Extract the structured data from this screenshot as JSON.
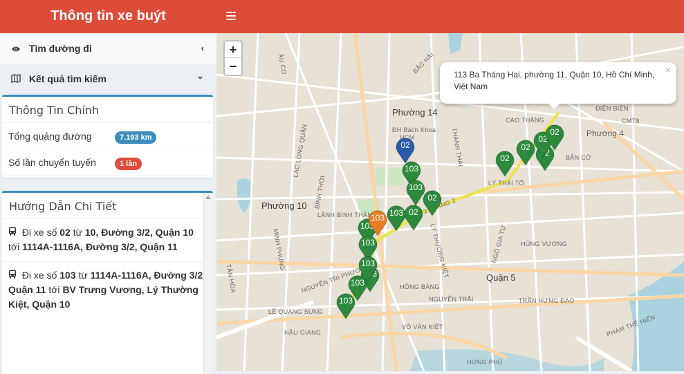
{
  "app": {
    "title": "Thông tin xe buýt"
  },
  "sidebar": {
    "nav": [
      {
        "label": "Tìm đường đi",
        "icon": "eye-icon",
        "chevron": "‹"
      },
      {
        "label": "Kết quả tìm kiếm",
        "icon": "map-icon",
        "chevron": "⌄"
      }
    ],
    "main_info": {
      "title": "Thông Tin Chính",
      "rows": [
        {
          "label": "Tổng quảng đường",
          "value": "7.193 km",
          "color": "#3c8dbc"
        },
        {
          "label": "Số lần chuyển tuyến",
          "value": "1 lần",
          "color": "#dd4b39"
        }
      ]
    },
    "details": {
      "title": "Hướng Dẫn Chi Tiết",
      "steps": [
        {
          "prefix": "Đi xe số ",
          "route": "02",
          "from_word": " từ ",
          "from": "10, Đường 3/2, Quận 10",
          "to_word": " tới ",
          "to": "1114A-1116A, Đường 3/2, Quận 11"
        },
        {
          "prefix": "Đi xe số ",
          "route": "103",
          "from_word": " từ ",
          "from": "1114A-1116A, Đường 3/2, Quận 11",
          "to_word": " tới ",
          "to": "BV Trưng Vương, Lý Thường Kiệt, Quận 10"
        }
      ]
    }
  },
  "map": {
    "zoom_in": "+",
    "zoom_out": "−",
    "popup": {
      "text": "113 Ba Tháng Hai, phường 11, Quận 10, Hồ Chí Minh, Việt Nam",
      "close": "×"
    },
    "labels": [
      "Phường 14",
      "Phường 10",
      "Phường 4",
      "Quận 5",
      "ĐH Bách Khoa",
      "HCM",
      "3 THÁNG 2",
      "LÝ THÁI TỔ",
      "LÝ THƯỜNG KIỆT",
      "HỒNG BÀNG",
      "NGUYỄN TRÃI",
      "TRẦN HƯNG ĐẠO",
      "HÙNG VƯƠNG",
      "NGUYỄN TRI PHƯƠNG",
      "LÊ QUANG SUNG",
      "HẬU GIANG",
      "CAO THẮNG",
      "BẮC HẢI",
      "CMT8",
      "LẠC LONG QUÂN",
      "BÌNH THỚI",
      "LÃNH BINH THĂNG",
      "MINH PHỤNG",
      "THÀNH THÁI",
      "NGÔ GIA TỰ",
      "VÕ VĂN KIỆT",
      "HƯNG PHÚ",
      "PHẠM THẾ HIỂN",
      "BẢN CỜ",
      "ÂU CƠ",
      "TÂN HÓA",
      "ĐIỆN BIÊN"
    ],
    "markers": [
      {
        "label": "02",
        "color": "#2c8a3c"
      },
      {
        "label": "02",
        "color": "#2c8a3c"
      },
      {
        "label": "02",
        "color": "#2c8a3c"
      },
      {
        "label": "02",
        "color": "#2c8a3c"
      },
      {
        "label": "02",
        "color": "#2c8a3c"
      },
      {
        "label": "02",
        "color": "#2c8a3c"
      },
      {
        "label": "02",
        "color": "#2c8a3c"
      },
      {
        "label": "103",
        "color": "#2c8a3c"
      },
      {
        "label": "103",
        "color": "#2c8a3c"
      },
      {
        "label": "103",
        "color": "#2c8a3c"
      },
      {
        "label": "103",
        "color": "#2c8a3c"
      },
      {
        "label": "103",
        "color": "#2c8a3c"
      },
      {
        "label": "103",
        "color": "#2c8a3c"
      },
      {
        "label": "103",
        "color": "#2c8a3c"
      },
      {
        "label": "103",
        "color": "#2c8a3c"
      },
      {
        "label": "103",
        "color": "#2c8a3c"
      },
      {
        "label": "103",
        "color": "#e67e22"
      },
      {
        "label": "02",
        "color": "#2a5caa"
      }
    ]
  }
}
